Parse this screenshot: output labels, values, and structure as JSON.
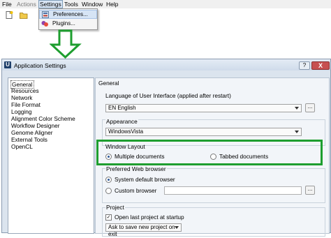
{
  "menubar": {
    "items": [
      {
        "label": "File"
      },
      {
        "label": "Actions"
      },
      {
        "label": "Settings"
      },
      {
        "label": "Tools"
      },
      {
        "label": "Window"
      },
      {
        "label": "Help"
      }
    ]
  },
  "settings_menu": {
    "items": [
      {
        "label": "Preferences..."
      },
      {
        "label": "Plugins..."
      }
    ]
  },
  "dialog": {
    "title": "Application Settings",
    "help_label": "?",
    "close_label": "X",
    "icon_label": "U",
    "nav_items": [
      "General",
      "Resources",
      "Network",
      "File Format",
      "Logging",
      "Alignment Color Scheme",
      "Workflow Designer",
      "Genome Aligner",
      "External Tools",
      "OpenCL"
    ],
    "selected_nav": "General",
    "section_title": "General",
    "language": {
      "label": "Language of User Interface (applied after restart)",
      "value": "EN English",
      "browse": "..."
    },
    "appearance": {
      "label": "Appearance",
      "value": "WindowsVista"
    },
    "window_layout": {
      "label": "Window Layout",
      "option1": "Multiple documents",
      "option2": "Tabbed documents",
      "selected": "Multiple documents"
    },
    "web_browser": {
      "label": "Preferred Web browser",
      "option1": "System default browser",
      "option2": "Custom browser",
      "selected": "System default browser",
      "browse": "..."
    },
    "project": {
      "label": "Project",
      "open_last": "Open last project at startup",
      "open_last_checked": true,
      "save_option": "Ask to save new project on exit",
      "check_mark": "✓"
    }
  },
  "colors": {
    "highlight_green": "#1e9e2f",
    "arrow_green": "#1e9e2f"
  }
}
